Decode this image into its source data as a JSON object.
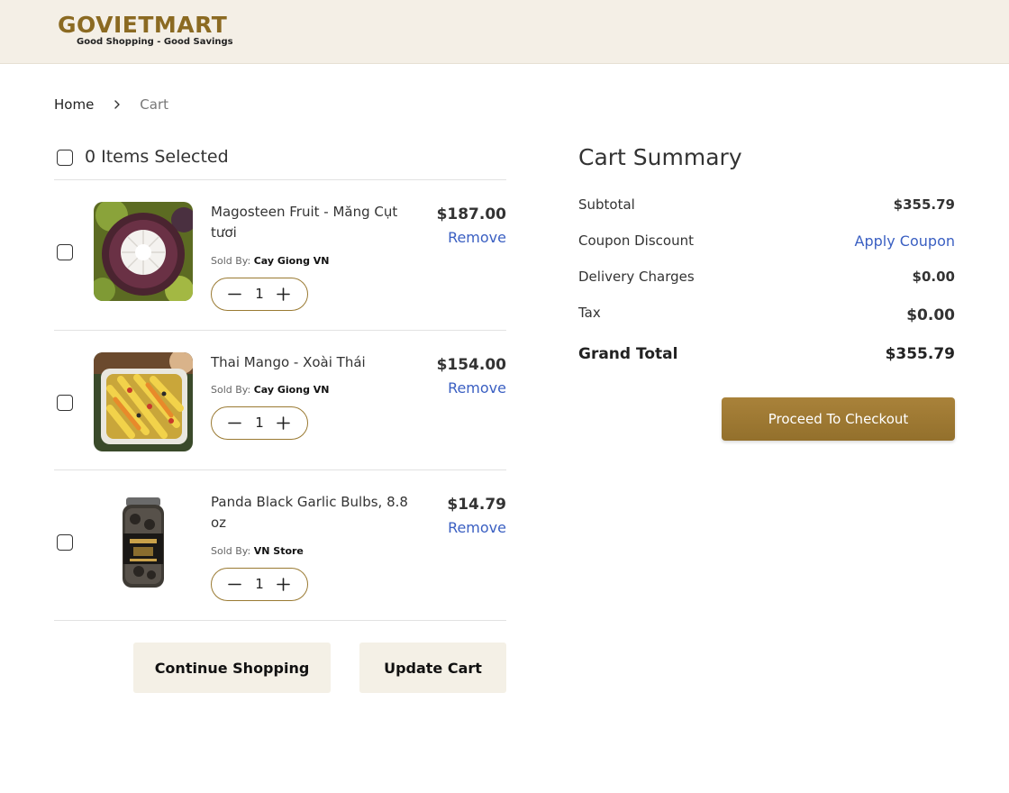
{
  "brand": {
    "name": "GOVIETMART",
    "tagline": "Good Shopping - Good Savings",
    "accent_color": "#8b6a22",
    "link_color": "#3a5fc2"
  },
  "breadcrumb": {
    "home": "Home",
    "separator_icon": "chevron-right-icon",
    "current": "Cart"
  },
  "cart": {
    "select_all_label": "0 Items Selected",
    "select_all_checked": false,
    "items": [
      {
        "name": "Magosteen Fruit - Măng Cụt tươi",
        "sold_by_label": "Sold By:",
        "seller": "Cay Giong VN",
        "quantity": "1",
        "price": "$187.00",
        "remove_label": "Remove",
        "checked": false
      },
      {
        "name": "Thai Mango - Xoài Thái",
        "sold_by_label": "Sold By:",
        "seller": "Cay Giong VN",
        "quantity": "1",
        "price": "$154.00",
        "remove_label": "Remove",
        "checked": false
      },
      {
        "name": "Panda Black Garlic Bulbs, 8.8 oz",
        "sold_by_label": "Sold By:",
        "seller": "VN Store",
        "quantity": "1",
        "price": "$14.79",
        "remove_label": "Remove",
        "checked": false
      }
    ],
    "continue_label": "Continue Shopping",
    "update_label": "Update Cart"
  },
  "summary": {
    "title": "Cart Summary",
    "subtotal_label": "Subtotal",
    "subtotal_value": "$355.79",
    "coupon_label": "Coupon Discount",
    "coupon_action": "Apply Coupon",
    "delivery_label": "Delivery Charges",
    "delivery_value": "$0.00",
    "tax_label": "Tax",
    "tax_value": "$0.00",
    "grand_label": "Grand Total",
    "grand_value": "$355.79",
    "checkout_label": "Proceed To Checkout"
  }
}
